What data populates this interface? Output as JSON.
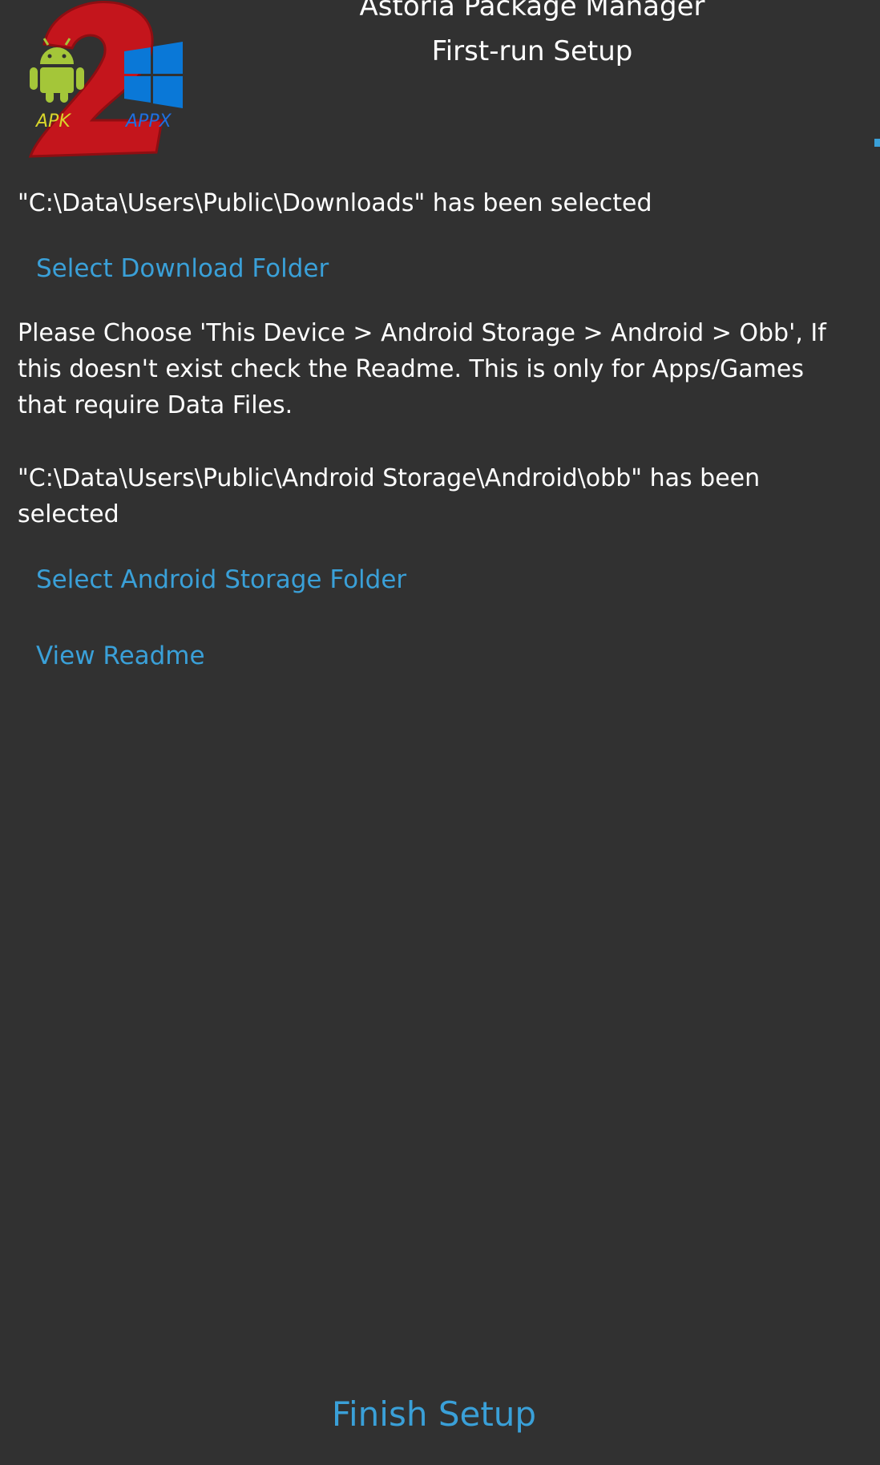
{
  "app": {
    "title_line1": "Astoria Package Manager",
    "title_line2": "First-run Setup"
  },
  "logo": {
    "icon": "apk2appx-logo",
    "apk_label": "APK",
    "appx_label": "APPX",
    "colors": {
      "badge_red": "#c4151c",
      "android_green": "#a4c639",
      "windows_blue": "#0a78d7"
    }
  },
  "download": {
    "status": "\"C:\\Data\\Users\\Public\\Downloads\" has been selected",
    "button_label": "Select Download Folder"
  },
  "android_storage": {
    "instructions": "Please Choose 'This Device > Android Storage > Android > Obb', If this doesn't exist check the Readme. This is only for Apps/Games that require Data Files.",
    "status": "\"C:\\Data\\Users\\Public\\Android Storage\\Android\\obb\" has been selected",
    "button_label": "Select Android Storage Folder"
  },
  "readme": {
    "button_label": "View Readme"
  },
  "footer": {
    "finish_label": "Finish Setup"
  },
  "theme": {
    "background": "#313131",
    "accent": "#3aa0d8",
    "text": "#ffffff"
  }
}
